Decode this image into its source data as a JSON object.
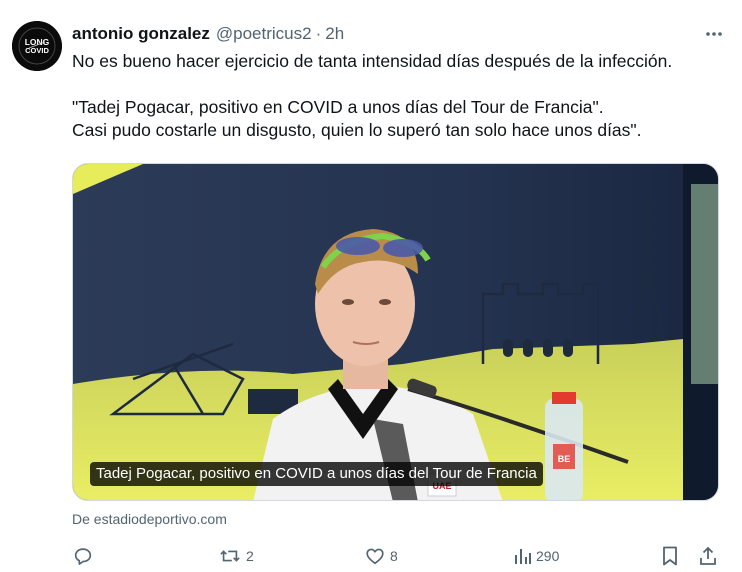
{
  "tweet": {
    "author_name": "antonio gonzalez",
    "author_handle": "@poetricus2",
    "separator": "·",
    "time": "2h",
    "avatar_text": [
      "LONG",
      "COVID"
    ],
    "text_lines": [
      "No es bueno hacer ejercicio de tanta intensidad días después de la infección.",
      "\"Tadej Pogacar, positivo en COVID a unos días del Tour de Francia\".",
      "Casi pudo costarle un disgusto, quien lo superó tan solo hace unos días\"."
    ],
    "media": {
      "caption": "Tadej Pogacar, positivo en COVID a unos días del Tour de Francia",
      "badge": "UAE",
      "bottle_label": "BE"
    },
    "source": "De estadiodeportivo.com"
  },
  "actions": {
    "replies": "",
    "retweets": "2",
    "likes": "8",
    "views": "290"
  },
  "colors": {
    "text": "#0f1419",
    "secondary": "#536471",
    "accent_yellow": "#e7ec5a",
    "navy": "#2b3a55"
  },
  "icons": [
    "more-icon",
    "reply-icon",
    "retweet-icon",
    "like-icon",
    "views-icon",
    "bookmark-icon",
    "share-icon"
  ]
}
